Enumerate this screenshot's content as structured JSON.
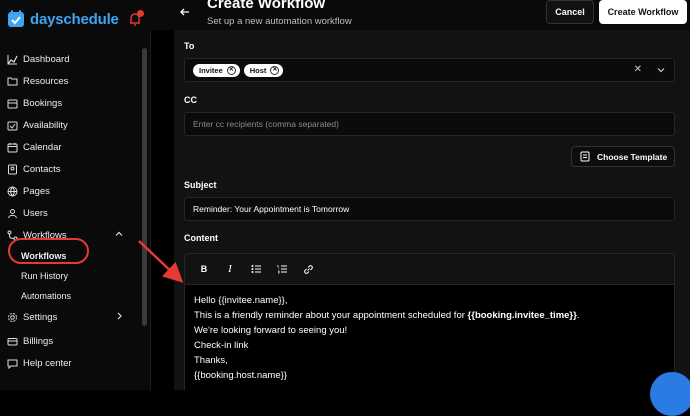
{
  "brand": {
    "name_part1": "day",
    "name_part2": "schedule",
    "accent": "#3da5f4"
  },
  "sidebar": {
    "items": [
      {
        "label": "Dashboard",
        "icon": "dashboard-icon"
      },
      {
        "label": "Resources",
        "icon": "folder-icon"
      },
      {
        "label": "Bookings",
        "icon": "bookings-icon"
      },
      {
        "label": "Availability",
        "icon": "calendar-check-icon"
      },
      {
        "label": "Calendar",
        "icon": "calendar-icon"
      },
      {
        "label": "Contacts",
        "icon": "contacts-icon"
      },
      {
        "label": "Pages",
        "icon": "globe-icon"
      },
      {
        "label": "Users",
        "icon": "users-icon"
      },
      {
        "label": "Workflows",
        "icon": "workflow-icon"
      }
    ],
    "sub_items": [
      "Workflows",
      "Run History",
      "Automations"
    ],
    "settings_label": "Settings",
    "billing_label": "Billings",
    "help_label": "Help center"
  },
  "header": {
    "title": "Create Workflow",
    "subtitle": "Set up a new automation workflow",
    "cancel_label": "Cancel",
    "create_label": "Create Workflow"
  },
  "form": {
    "to_label": "To",
    "to_chips": [
      "Invitee",
      "Host"
    ],
    "cc_label": "CC",
    "cc_placeholder": "Enter cc recipients (comma separated)",
    "template_button": "Choose Template",
    "subject_label": "Subject",
    "subject_value": "Reminder: Your Appointment is Tomorrow",
    "content_label": "Content",
    "content_lines": {
      "l1": "Hello {{invitee.name}},",
      "l2a": "This is a friendly reminder about your appointment scheduled for ",
      "l2b": "{{booking.invitee_time}}",
      "l2c": ".",
      "l3": "We're looking forward to seeing you!",
      "l4": "Check-in link",
      "l5": "Thanks,",
      "l6": "{{booking.host.name}}"
    }
  },
  "colors": {
    "highlight": "#e53935",
    "background": "#121212"
  }
}
